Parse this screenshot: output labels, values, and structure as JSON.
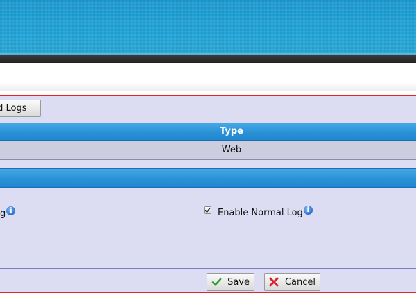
{
  "toolbar": {
    "related_logs_label": "ted Logs"
  },
  "table": {
    "columns": [
      "Type"
    ],
    "rows": [
      [
        "Web"
      ]
    ]
  },
  "options": {
    "left_label": "g",
    "right_label": "Enable Normal Log",
    "right_checked": true,
    "info_glyph": "i"
  },
  "actions": {
    "save_label": "Save",
    "cancel_label": "Cancel"
  },
  "icons": {
    "save": "checkmark-icon",
    "cancel": "red-x-icon",
    "info": "info-icon"
  },
  "colors": {
    "banner": "#1f9fd2",
    "header_blue": "#2d93d8",
    "panel_bg": "#dcdcf2",
    "accent_red": "#e0262a"
  }
}
